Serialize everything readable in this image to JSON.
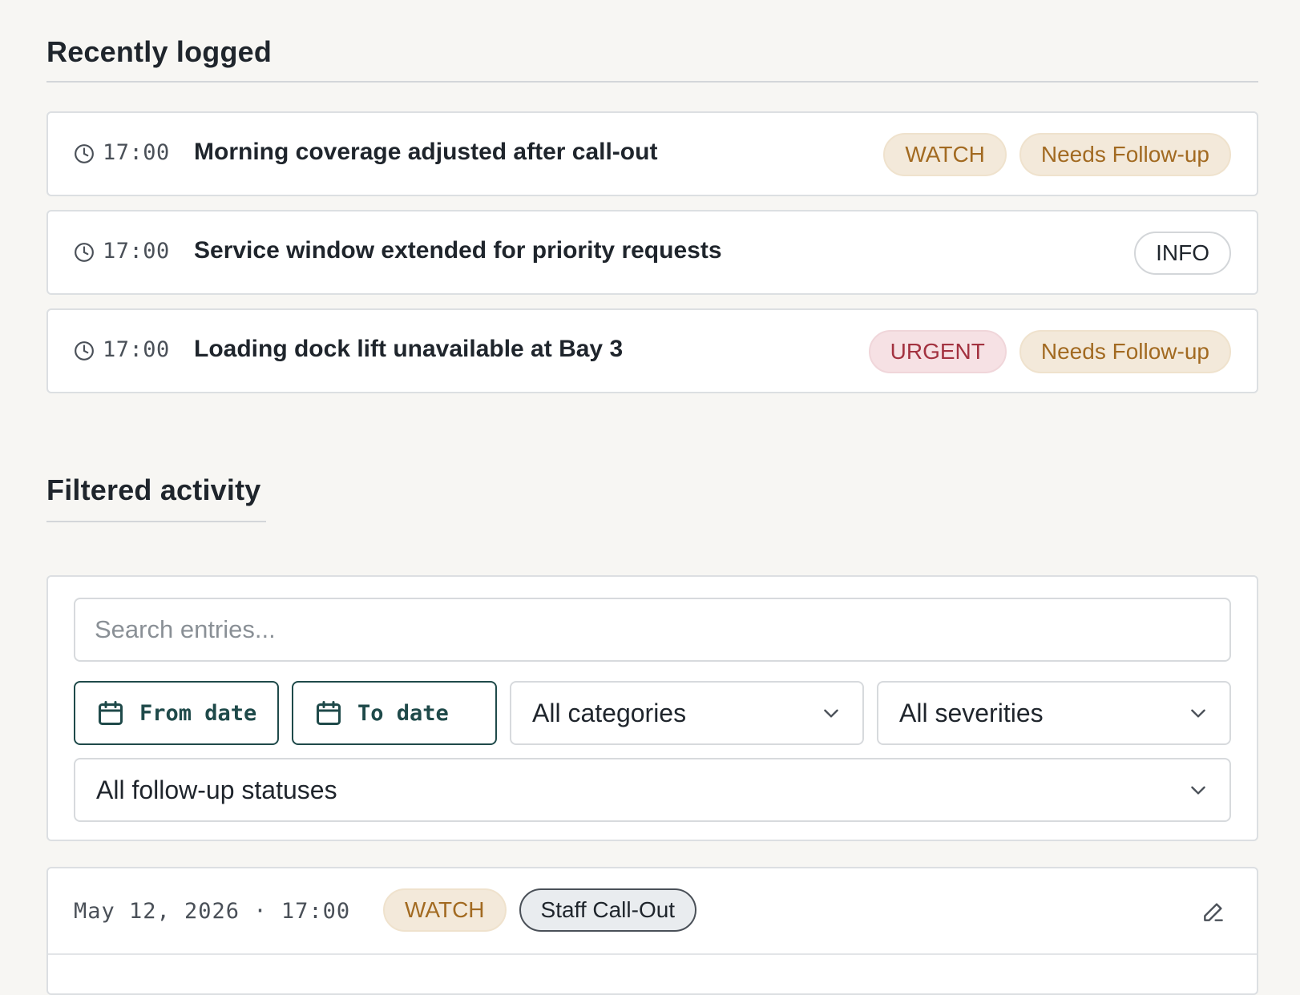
{
  "recent": {
    "heading": "Recently logged",
    "rows": [
      {
        "time": "17:00",
        "title": "Morning coverage adjusted after call-out",
        "badges": [
          {
            "label": "WATCH",
            "kind": "watch"
          },
          {
            "label": "Needs Follow-up",
            "kind": "follow"
          }
        ]
      },
      {
        "time": "17:00",
        "title": "Service window extended for priority requests",
        "badges": [
          {
            "label": "INFO",
            "kind": "info"
          }
        ]
      },
      {
        "time": "17:00",
        "title": "Loading dock lift unavailable at Bay 3",
        "badges": [
          {
            "label": "URGENT",
            "kind": "urgent"
          },
          {
            "label": "Needs Follow-up",
            "kind": "follow"
          }
        ]
      }
    ]
  },
  "filtered": {
    "heading": "Filtered activity",
    "search_placeholder": "Search entries...",
    "from_date_label": "From date",
    "to_date_label": "To date",
    "category_select": "All categories",
    "severity_select": "All severities",
    "followup_select": "All follow-up statuses"
  },
  "entry": {
    "meta": "May 12, 2026 · 17:00",
    "severity": "WATCH",
    "category": "Staff Call-Out"
  },
  "icons": {
    "clock": "clock-icon",
    "calendar": "calendar-icon",
    "chevron": "chevron-down-icon",
    "edit": "pencil-icon"
  },
  "colors": {
    "background": "#f7f6f3",
    "watch": "#a26a21",
    "urgent": "#a33240",
    "accent": "#1f4a4a"
  }
}
